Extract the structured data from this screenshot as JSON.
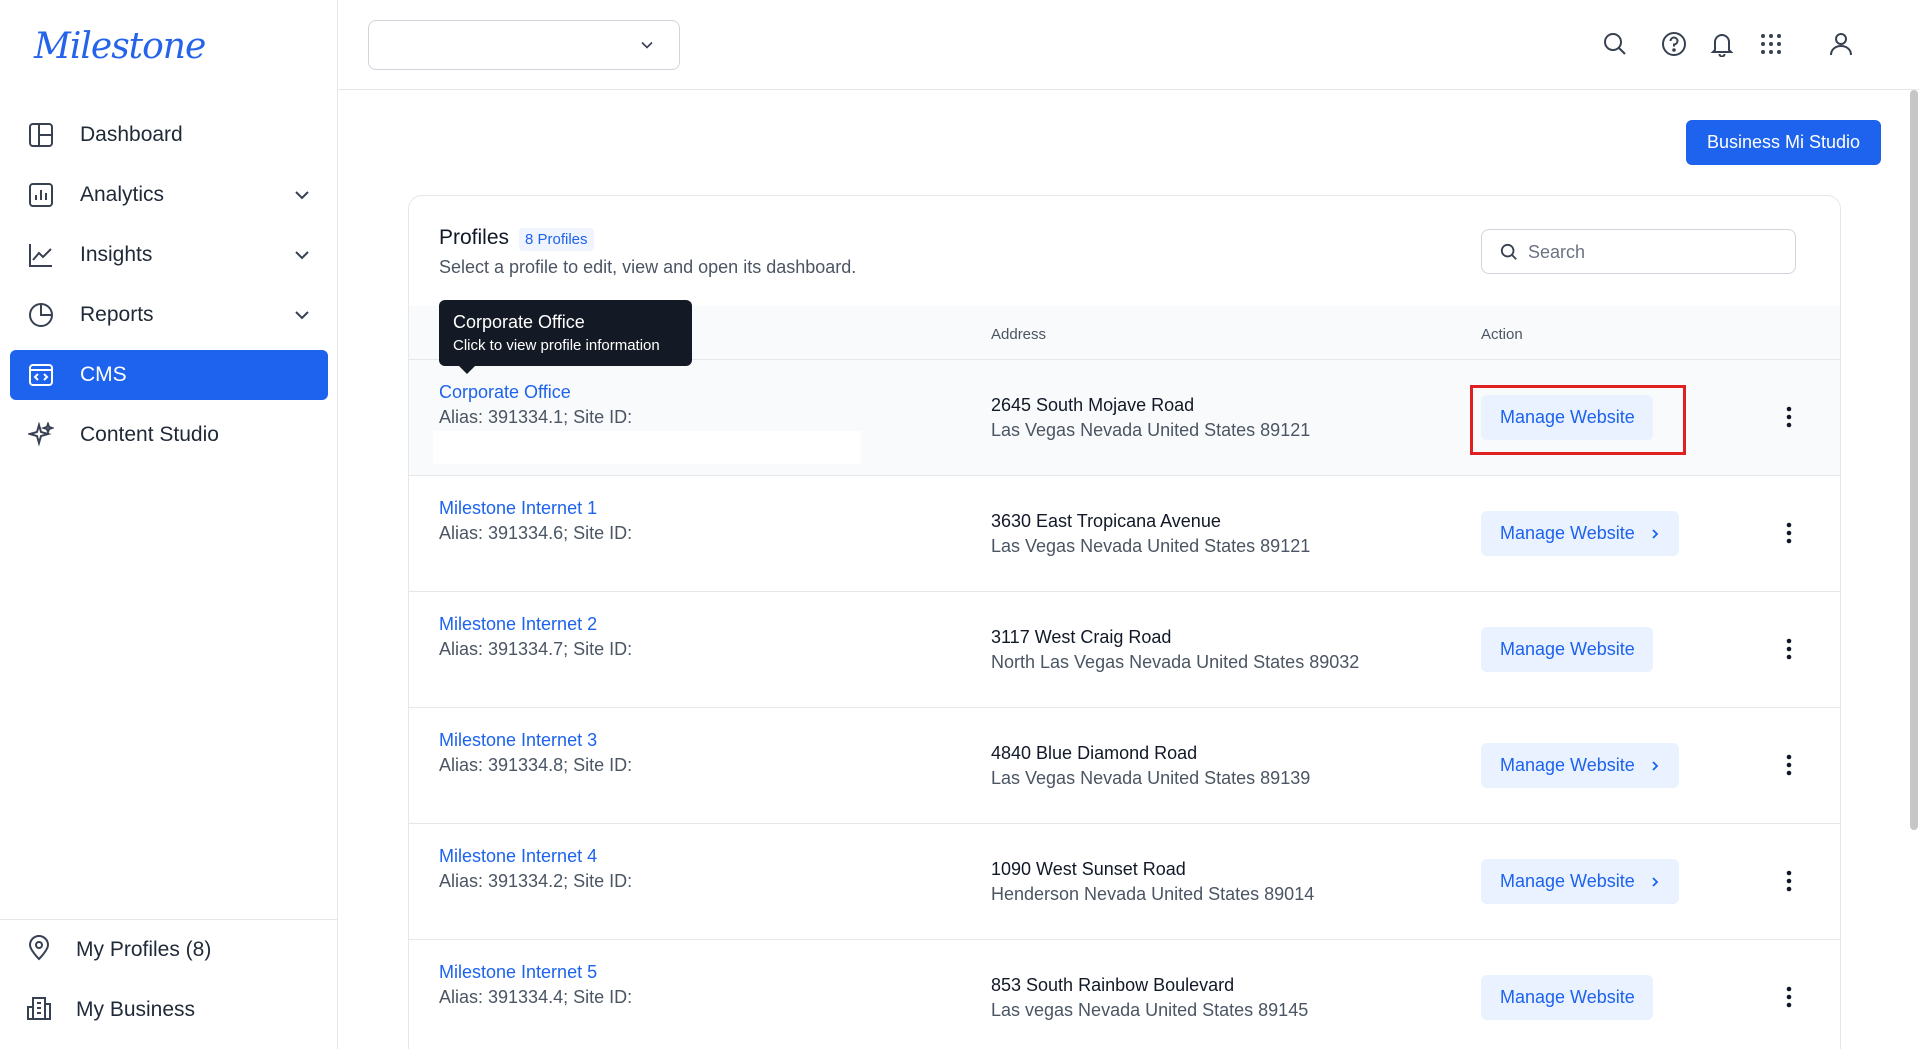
{
  "app": {
    "logo": "Milestone"
  },
  "sidebar": {
    "items": [
      {
        "label": "Dashboard",
        "icon": "dashboard-icon",
        "expandable": false,
        "active": false
      },
      {
        "label": "Analytics",
        "icon": "analytics-icon",
        "expandable": true,
        "active": false
      },
      {
        "label": "Insights",
        "icon": "insights-icon",
        "expandable": true,
        "active": false
      },
      {
        "label": "Reports",
        "icon": "reports-icon",
        "expandable": true,
        "active": false
      },
      {
        "label": "CMS",
        "icon": "cms-icon",
        "expandable": false,
        "active": true
      },
      {
        "label": "Content Studio",
        "icon": "sparkle-icon",
        "expandable": false,
        "active": false
      }
    ],
    "bottom": [
      {
        "label": "My Profiles (8)",
        "icon": "location-pin-icon"
      },
      {
        "label": "My Business",
        "icon": "building-icon"
      }
    ]
  },
  "header": {
    "select_value": "",
    "icons": [
      "search-icon",
      "help-icon",
      "bell-icon",
      "apps-grid-icon",
      "user-icon"
    ]
  },
  "main": {
    "primary_button": "Business Mi Studio",
    "card": {
      "title": "Profiles",
      "badge": "8 Profiles",
      "subtitle": "Select a profile to edit, view and open its dashboard.",
      "search_placeholder": "Search",
      "columns": {
        "address": "Address",
        "action": "Action"
      },
      "tooltip": {
        "title": "Corporate Office",
        "text": "Click to view profile information"
      },
      "rows": [
        {
          "name": "Corporate Office",
          "alias": "Alias: 391334.1; Site ID:",
          "address1": "2645 South Mojave Road",
          "address2": "Las Vegas Nevada United States 89121",
          "action": "Manage Website",
          "arrow": false
        },
        {
          "name": "Milestone Internet 1",
          "alias": "Alias: 391334.6; Site ID:",
          "address1": "3630 East Tropicana Avenue",
          "address2": "Las Vegas Nevada United States 89121",
          "action": "Manage Website",
          "arrow": true
        },
        {
          "name": "Milestone Internet 2",
          "alias": "Alias: 391334.7; Site ID:",
          "address1": "3117 West Craig Road",
          "address2": "North Las Vegas Nevada United States 89032",
          "action": "Manage Website",
          "arrow": false
        },
        {
          "name": "Milestone Internet 3",
          "alias": "Alias: 391334.8; Site ID:",
          "address1": "4840 Blue Diamond Road",
          "address2": "Las Vegas Nevada United States 89139",
          "action": "Manage Website",
          "arrow": true
        },
        {
          "name": "Milestone Internet 4",
          "alias": "Alias: 391334.2; Site ID:",
          "address1": "1090 West Sunset Road",
          "address2": "Henderson Nevada United States 89014",
          "action": "Manage Website",
          "arrow": true
        },
        {
          "name": "Milestone Internet 5",
          "alias": "Alias: 391334.4; Site ID:",
          "address1": "853 South Rainbow Boulevard",
          "address2": "Las vegas Nevada United States 89145",
          "action": "Manage Website",
          "arrow": false
        }
      ]
    }
  },
  "colors": {
    "accent": "#1d63ed",
    "highlight_box": "#e02020",
    "tooltip_bg": "#141a25"
  }
}
